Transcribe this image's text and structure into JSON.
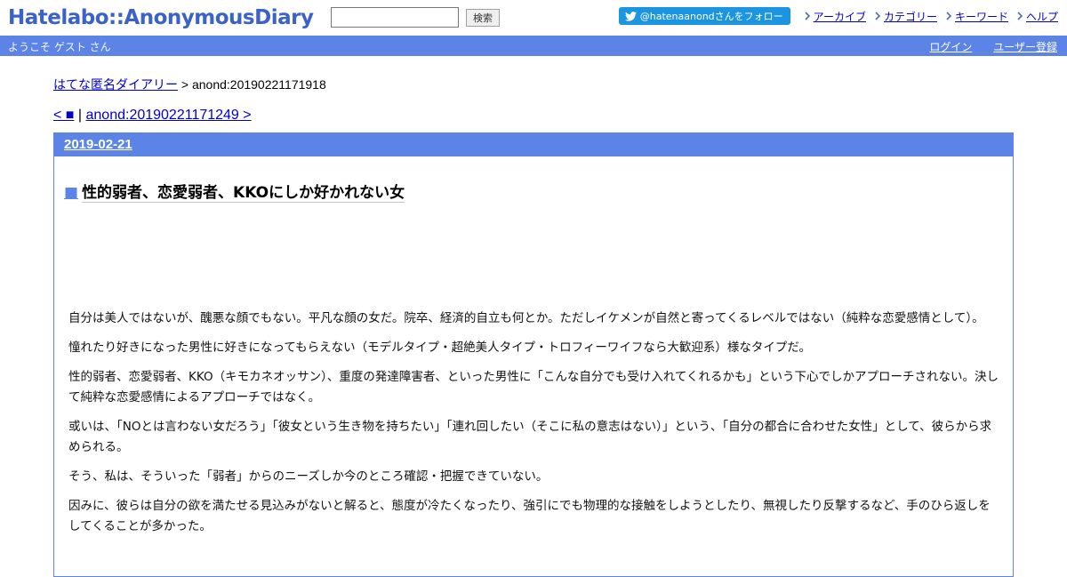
{
  "header": {
    "logo": "Hatelabo::AnonymousDiary",
    "search_value": "",
    "search_button": "検索",
    "twitter_follow": "@hatenaanondさんをフォロー",
    "nav": [
      "アーカイブ",
      "カテゴリー",
      "キーワード",
      "ヘルプ"
    ]
  },
  "bar": {
    "welcome": "ようこそ ゲスト さん",
    "login": "ログイン",
    "register": "ユーザー登録"
  },
  "breadcrumb": {
    "home": "はてな匿名ダイアリー",
    "separator": " > ",
    "current": "anond:20190221171918"
  },
  "pager": {
    "prev": "< ■",
    "separator": " | ",
    "next": "anond:20190221171249 >"
  },
  "day": {
    "date": "2019-02-21",
    "section_mark": "■",
    "title": "性的弱者、恋愛弱者、KKOにしか好かれない女",
    "paragraphs": [
      "自分は美人ではないが、醜悪な顔でもない。平凡な顔の女だ。院卒、経済的自立も何とか。ただしイケメンが自然と寄ってくるレベルではない（純粋な恋愛感情として）。",
      "憧れたり好きになった男性に好きになってもらえない（モデルタイプ・超絶美人タイプ・トロフィーワイフなら大歓迎系）様なタイプだ。",
      "性的弱者、恋愛弱者、KKO（キモカネオッサン）、重度の発達障害者、といった男性に「こんな自分でも受け入れてくれるかも」という下心でしかアプローチされない。決して純粋な恋愛感情によるアプローチではなく。",
      "或いは、「NOとは言わない女だろう」「彼女という生き物を持ちたい」「連れ回したい（そこに私の意志はない）」という、「自分の都合に合わせた女性」として、彼らから求められる。",
      "そう、私は、そういった「弱者」からのニーズしか今のところ確認・把握できていない。",
      "因みに、彼らは自分の欲を満たせる見込みがないと解ると、態度が冷たくなったり、強引にでも物理的な接触をしようとしたり、無視したり反撃するなど、手のひら返しをしてくることが多かった。"
    ]
  },
  "colors": {
    "logo": "#3b63c7",
    "bar": "#5c83e6",
    "twitter": "#1b95e0",
    "link": "#0000cc"
  }
}
